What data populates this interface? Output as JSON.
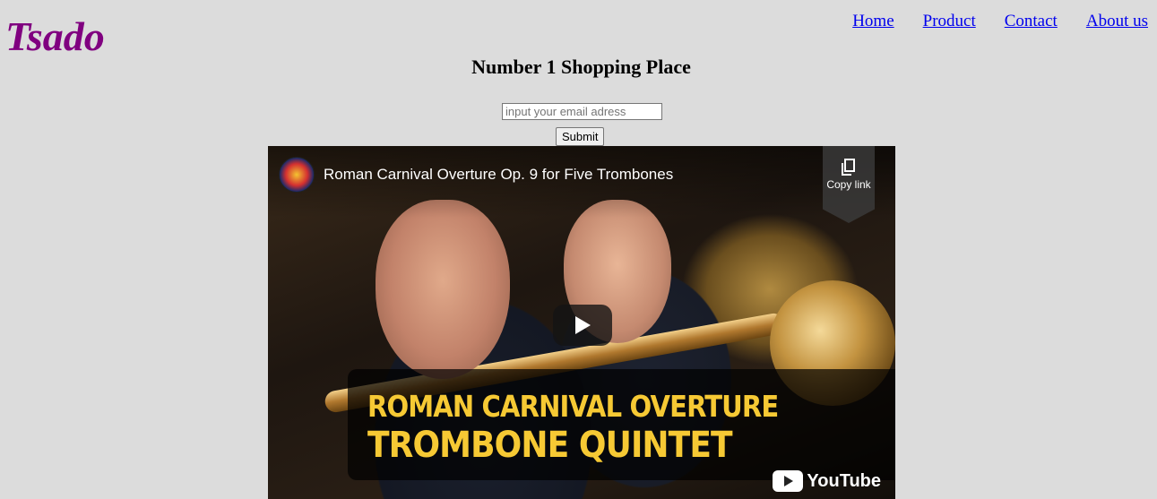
{
  "logo": "Tsado",
  "nav": {
    "home": "Home",
    "product": "Product",
    "contact": "Contact",
    "about": "About us"
  },
  "headline": "Number 1 Shopping Place",
  "form": {
    "email_placeholder": "input your email adress",
    "submit_label": "Submit"
  },
  "video": {
    "title": "Roman Carnival Overture Op. 9 for Five Trombones",
    "copy_link_label": "Copy link",
    "thumbnail_line1": "ROMAN CARNIVAL OVERTURE",
    "thumbnail_line2": "TROMBONE QUINTET",
    "platform": "YouTube"
  },
  "colors": {
    "logo": "#800080",
    "link": "#0000ee",
    "background": "#dcdcdc",
    "thumbnail_text": "#f6c934"
  }
}
